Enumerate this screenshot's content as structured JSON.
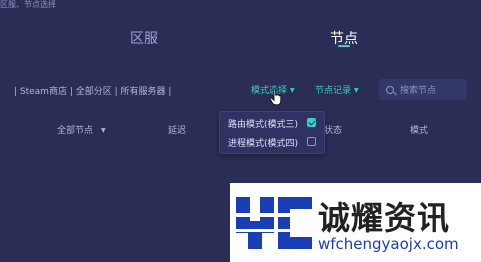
{
  "top_hint": "区服、节点选择",
  "tabs": [
    {
      "label": "区服",
      "active": false
    },
    {
      "label": "节点",
      "active": true
    }
  ],
  "filter_path": "| Steam商店 | 全部分区 | 所有服务器 |",
  "mode_select": {
    "label": "模式选择"
  },
  "node_record": {
    "label": "节点记录"
  },
  "search": {
    "placeholder": "搜索节点"
  },
  "columns": {
    "all_nodes": "全部节点",
    "latency": "延迟",
    "status_partial": "状态",
    "mode": "模式"
  },
  "mode_menu": {
    "options": [
      {
        "label": "路由模式(模式三)",
        "checked": true
      },
      {
        "label": "进程模式(模式四)",
        "checked": false
      }
    ]
  },
  "watermark": {
    "brand": "诚耀资讯",
    "domain": "wfchengyaojx.com"
  },
  "colors": {
    "background": "#2a2d55",
    "accent": "#36d0c7",
    "watermark_blue": "#1a3fb5"
  }
}
